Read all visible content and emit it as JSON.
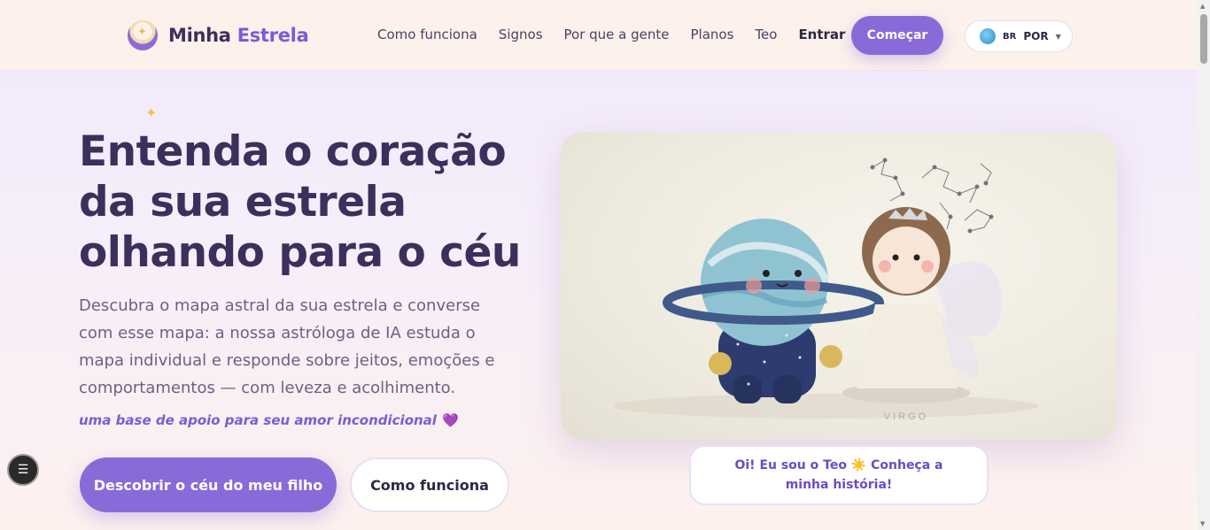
{
  "brand": {
    "name_part1": "Minha",
    "name_part2": "Estrela"
  },
  "nav": {
    "items": [
      "Como funciona",
      "Signos",
      "Por que a gente",
      "Planos",
      "Teo"
    ],
    "login": "Entrar",
    "cta": "Começar"
  },
  "language": {
    "flag": "BR",
    "code": "POR"
  },
  "hero": {
    "title_line1": "Entenda o coração",
    "title_line2": "da sua estrela",
    "title_line3": "olhando para o céu",
    "description": "Descubra o mapa astral da sua estrela e converse com esse mapa: a nossa astróloga de IA estuda o mapa individual e responde sobre jeitos, emoções e comportamentos — com leveza e acolhimento.",
    "tagline": "uma base de apoio para seu amor incondicional",
    "primary_button": "Descobrir o céu do meu filho",
    "secondary_button": "Como funciona"
  },
  "image": {
    "plaque_text": "VIRGO"
  },
  "teo_bubble": {
    "text": "Oi! Eu sou o Teo ☀️ Conheça a minha história!"
  },
  "colors": {
    "accent": "#8a6ad9",
    "title": "#3d2f5c",
    "header_bg": "#fdf1ec"
  }
}
